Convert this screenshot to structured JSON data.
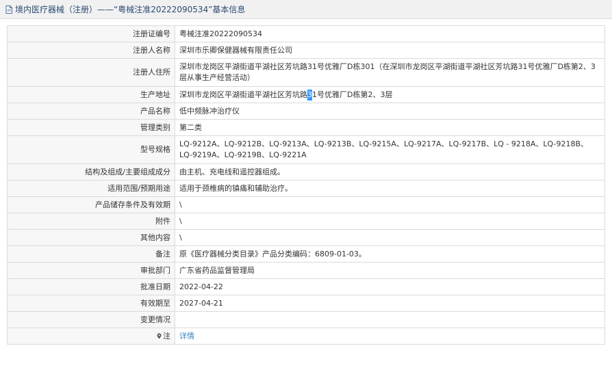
{
  "header": {
    "title": "境内医疗器械（注册）——“粤械注准20222090534”基本信息",
    "icon": "document-icon"
  },
  "rows": [
    {
      "label": "注册证编号",
      "value": "粤械注准20222090534"
    },
    {
      "label": "注册人名称",
      "value": "深圳市乐卿保健器械有限责任公司"
    },
    {
      "label": "注册人住所",
      "value": "深圳市龙岗区平湖街道平湖社区芳坑路31号优雅厂D栋301（在深圳市龙岗区平湖街道平湖社区芳坑路31号优雅厂D栋第2、3层从事生产经营活动）"
    },
    {
      "label": "生产地址",
      "value_before": "深圳市龙岗区平湖街道平湖社区芳坑路",
      "value_selected": "3",
      "value_after": "1号优雅厂D栋第2、3层"
    },
    {
      "label": "产品名称",
      "value": "低中频脉冲治疗仪"
    },
    {
      "label": "管理类别",
      "value": "第二类"
    },
    {
      "label": "型号规格",
      "value": "LQ-9212A、LQ-9212B、LQ-9213A、LQ-9213B、LQ-9215A、LQ-9217A、LQ-9217B、LQ - 9218A、LQ-9218B、LQ-9219A、LQ-9219B、LQ-9221A"
    },
    {
      "label": "结构及组成/主要组成成分",
      "value": "由主机、充电线和遥控器组成。"
    },
    {
      "label": "适用范围/预期用途",
      "value": "适用于颈椎病的镇痛和辅助治疗。"
    },
    {
      "label": "产品储存条件及有效期",
      "value": "\\"
    },
    {
      "label": "附件",
      "value": "\\"
    },
    {
      "label": "其他内容",
      "value": "\\"
    },
    {
      "label": "备注",
      "value": "原《医疗器械分类目录》产品分类编码：6809-01-03。"
    },
    {
      "label": "审批部门",
      "value": "广东省药品监督管理局"
    },
    {
      "label": "批准日期",
      "value": "2022-04-22"
    },
    {
      "label": "有效期至",
      "value": "2027-04-21"
    },
    {
      "label": "变更情况",
      "value": ""
    },
    {
      "label": "注",
      "value": "详情",
      "icon": "pin-icon"
    }
  ],
  "colors": {
    "header_bg": "#f1f1f1",
    "header_text": "#2c4a73",
    "label_bg": "#f7f7f7",
    "border": "#dadada",
    "link": "#3b82c4",
    "selection": "#3399ff"
  }
}
